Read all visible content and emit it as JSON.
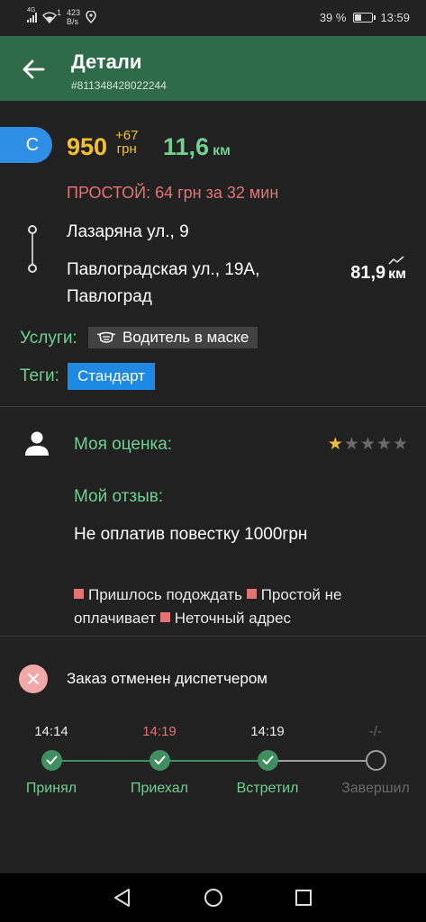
{
  "status_bar": {
    "signal_label": "4G",
    "notification_count": "1",
    "net_speed_value": "423",
    "net_speed_unit": "B/s",
    "battery_percent": "39 %",
    "battery_level": 0.39,
    "time": "13:59"
  },
  "header": {
    "title": "Детали",
    "order_number": "#811348428022244"
  },
  "order": {
    "class_label": "С",
    "price": "950",
    "price_extra": "+67",
    "price_currency": "грн",
    "distance": "11,6",
    "distance_unit": "км",
    "idle_text": "ПРОСТОЙ: 64 грн за 32 мин",
    "pickup_address": "Лазаряна ул., 9",
    "dropoff_address_line1": "Павлоградская ул., 19А,",
    "dropoff_address_line2": "Павлоград",
    "trip_distance": "81,9",
    "trip_distance_unit": "км"
  },
  "services": {
    "label": "Услуги:",
    "item": "Водитель в маске"
  },
  "tags": {
    "label": "Теги:",
    "item": "Стандарт"
  },
  "rating": {
    "label": "Моя оценка:",
    "value": 1,
    "max": 5,
    "review_label": "Мой отзыв:",
    "review_text": "Не оплатив повестку 1000грн",
    "reasons": [
      "Пришлось подождать",
      "Простой не оплачивает",
      "Неточный адрес"
    ]
  },
  "cancel": {
    "text": "Заказ отменен диспетчером"
  },
  "timeline": [
    {
      "time": "14:14",
      "label": "Принял",
      "status": "done",
      "time_color": "#eeeeee"
    },
    {
      "time": "14:19",
      "label": "Приехал",
      "status": "done",
      "time_color": "#e57373"
    },
    {
      "time": "14:19",
      "label": "Встретил",
      "status": "done",
      "time_color": "#eeeeee"
    },
    {
      "time": "-/-",
      "label": "Завершил",
      "status": "pending",
      "time_color": "#6a6a6a"
    }
  ],
  "colors": {
    "app_bar": "#2f6b49",
    "accent_green": "#6fd091",
    "price_yellow": "#f4c030",
    "alert_red": "#e57373",
    "tag_blue": "#1e88e5"
  }
}
